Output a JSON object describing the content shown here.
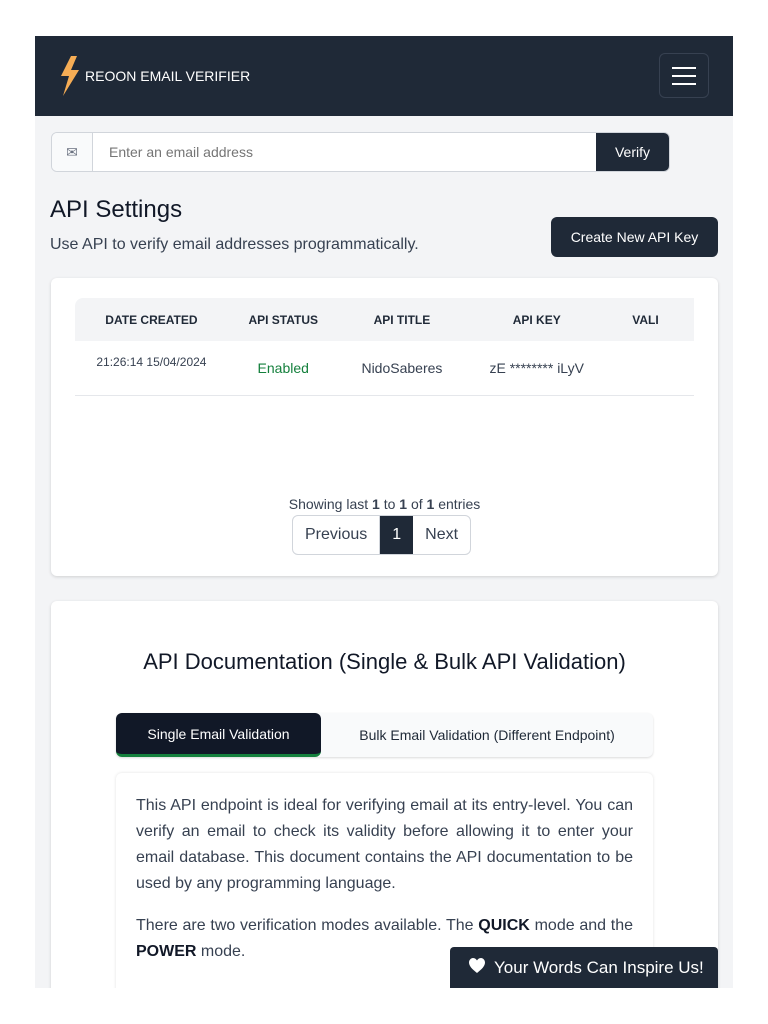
{
  "nav": {
    "brand": "REOON EMAIL VERIFIER",
    "brand_color": "#f6ad55"
  },
  "search": {
    "placeholder": "Enter an email address",
    "verify_label": "Verify"
  },
  "api": {
    "title": "API Settings",
    "subtitle": "Use API to verify email addresses programmatically.",
    "create_label": "Create New API Key"
  },
  "table": {
    "headers": [
      "DATE CREATED",
      "API STATUS",
      "API TITLE",
      "API KEY",
      "VALI"
    ],
    "rows": [
      {
        "date": "21:26:14 15/04/2024",
        "status": "Enabled",
        "title": "NidoSaberes",
        "key": "zE ******** iLyV"
      }
    ]
  },
  "pagination": {
    "showing_prefix": "Showing last ",
    "from": "1",
    "to_word": " to ",
    "to": "1",
    "of_word": " of ",
    "total": "1",
    "suffix": " entries",
    "previous": "Previous",
    "page": "1",
    "next": "Next"
  },
  "docs": {
    "title": "API Documentation (Single & Bulk API Validation)",
    "tabs": [
      "Single Email Validation",
      "Bulk Email Validation (Different Endpoint)"
    ],
    "p1": "This API endpoint is ideal for verifying email at its entry-level. You can verify an email to check its validity before allowing it to enter your email database. This document contains the API documentation to be used by any programming language.",
    "p2_a": "There are two verification modes available. The ",
    "p2_quick": "QUICK",
    "p2_b": " mode and the ",
    "p2_power": "POWER",
    "p2_c": " mode."
  },
  "feedback": {
    "label": "Your Words Can Inspire Us!"
  }
}
